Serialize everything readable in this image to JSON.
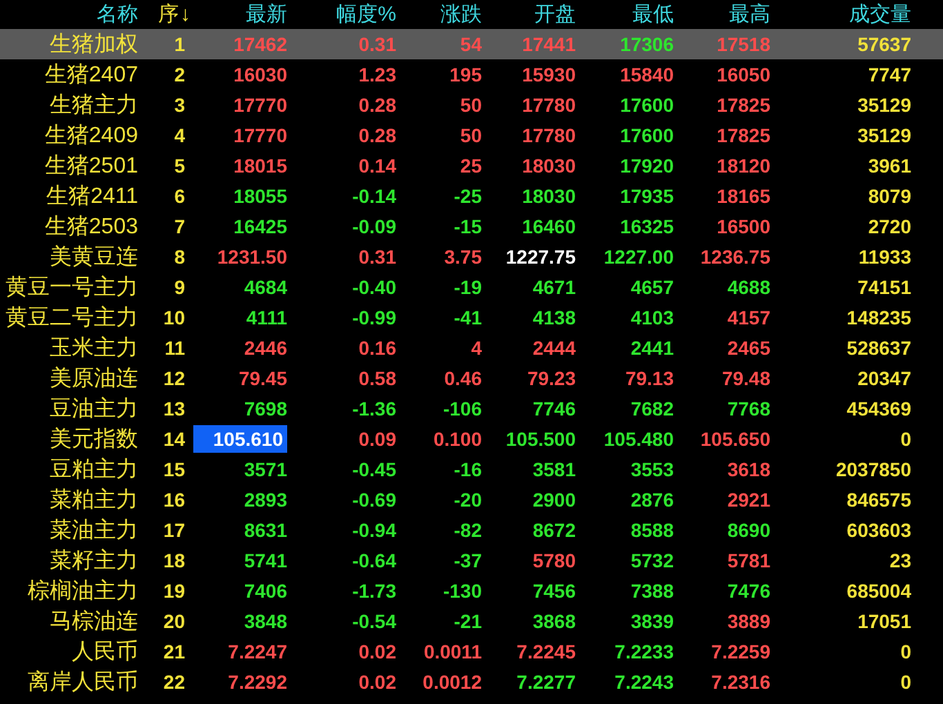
{
  "columns": [
    {
      "label": "名称",
      "kind": "name"
    },
    {
      "label": "序",
      "kind": "index",
      "sort_indicator": "↓"
    },
    {
      "label": "最新",
      "kind": "price"
    },
    {
      "label": "幅度%",
      "kind": "price"
    },
    {
      "label": "涨跌",
      "kind": "price"
    },
    {
      "label": "开盘",
      "kind": "price"
    },
    {
      "label": "最低",
      "kind": "price"
    },
    {
      "label": "最高",
      "kind": "price"
    },
    {
      "label": "成交量",
      "kind": "volume"
    }
  ],
  "rows": [
    {
      "name": "生猪加权",
      "no": "1",
      "selected": true,
      "cells": [
        {
          "v": "17462",
          "kind": "up"
        },
        {
          "v": "0.31",
          "kind": "up"
        },
        {
          "v": "54",
          "kind": "up"
        },
        {
          "v": "17441",
          "kind": "up"
        },
        {
          "v": "17306",
          "kind": "down"
        },
        {
          "v": "17518",
          "kind": "up"
        }
      ],
      "volume": "57637"
    },
    {
      "name": "生猪2407",
      "no": "2",
      "selected": false,
      "cells": [
        {
          "v": "16030",
          "kind": "up"
        },
        {
          "v": "1.23",
          "kind": "up"
        },
        {
          "v": "195",
          "kind": "up"
        },
        {
          "v": "15930",
          "kind": "up"
        },
        {
          "v": "15840",
          "kind": "up"
        },
        {
          "v": "16050",
          "kind": "up"
        }
      ],
      "volume": "7747"
    },
    {
      "name": "生猪主力",
      "no": "3",
      "selected": false,
      "cells": [
        {
          "v": "17770",
          "kind": "up"
        },
        {
          "v": "0.28",
          "kind": "up"
        },
        {
          "v": "50",
          "kind": "up"
        },
        {
          "v": "17780",
          "kind": "up"
        },
        {
          "v": "17600",
          "kind": "down"
        },
        {
          "v": "17825",
          "kind": "up"
        }
      ],
      "volume": "35129"
    },
    {
      "name": "生猪2409",
      "no": "4",
      "selected": false,
      "cells": [
        {
          "v": "17770",
          "kind": "up"
        },
        {
          "v": "0.28",
          "kind": "up"
        },
        {
          "v": "50",
          "kind": "up"
        },
        {
          "v": "17780",
          "kind": "up"
        },
        {
          "v": "17600",
          "kind": "down"
        },
        {
          "v": "17825",
          "kind": "up"
        }
      ],
      "volume": "35129"
    },
    {
      "name": "生猪2501",
      "no": "5",
      "selected": false,
      "cells": [
        {
          "v": "18015",
          "kind": "up"
        },
        {
          "v": "0.14",
          "kind": "up"
        },
        {
          "v": "25",
          "kind": "up"
        },
        {
          "v": "18030",
          "kind": "up"
        },
        {
          "v": "17920",
          "kind": "down"
        },
        {
          "v": "18120",
          "kind": "up"
        }
      ],
      "volume": "3961"
    },
    {
      "name": "生猪2411",
      "no": "6",
      "selected": false,
      "cells": [
        {
          "v": "18055",
          "kind": "down"
        },
        {
          "v": "-0.14",
          "kind": "down"
        },
        {
          "v": "-25",
          "kind": "down"
        },
        {
          "v": "18030",
          "kind": "down"
        },
        {
          "v": "17935",
          "kind": "down"
        },
        {
          "v": "18165",
          "kind": "up"
        }
      ],
      "volume": "8079"
    },
    {
      "name": "生猪2503",
      "no": "7",
      "selected": false,
      "cells": [
        {
          "v": "16425",
          "kind": "down"
        },
        {
          "v": "-0.09",
          "kind": "down"
        },
        {
          "v": "-15",
          "kind": "down"
        },
        {
          "v": "16460",
          "kind": "down"
        },
        {
          "v": "16325",
          "kind": "down"
        },
        {
          "v": "16500",
          "kind": "up"
        }
      ],
      "volume": "2720"
    },
    {
      "name": "美黄豆连",
      "no": "8",
      "selected": false,
      "cells": [
        {
          "v": "1231.50",
          "kind": "up"
        },
        {
          "v": "0.31",
          "kind": "up"
        },
        {
          "v": "3.75",
          "kind": "up"
        },
        {
          "v": "1227.75",
          "kind": "flat"
        },
        {
          "v": "1227.00",
          "kind": "down"
        },
        {
          "v": "1236.75",
          "kind": "up"
        }
      ],
      "volume": "11933"
    },
    {
      "name": "黄豆一号主力",
      "no": "9",
      "selected": false,
      "cells": [
        {
          "v": "4684",
          "kind": "down"
        },
        {
          "v": "-0.40",
          "kind": "down"
        },
        {
          "v": "-19",
          "kind": "down"
        },
        {
          "v": "4671",
          "kind": "down"
        },
        {
          "v": "4657",
          "kind": "down"
        },
        {
          "v": "4688",
          "kind": "down"
        }
      ],
      "volume": "74151"
    },
    {
      "name": "黄豆二号主力",
      "no": "10",
      "selected": false,
      "cells": [
        {
          "v": "4111",
          "kind": "down"
        },
        {
          "v": "-0.99",
          "kind": "down"
        },
        {
          "v": "-41",
          "kind": "down"
        },
        {
          "v": "4138",
          "kind": "down"
        },
        {
          "v": "4103",
          "kind": "down"
        },
        {
          "v": "4157",
          "kind": "up"
        }
      ],
      "volume": "148235"
    },
    {
      "name": "玉米主力",
      "no": "11",
      "selected": false,
      "cells": [
        {
          "v": "2446",
          "kind": "up"
        },
        {
          "v": "0.16",
          "kind": "up"
        },
        {
          "v": "4",
          "kind": "up"
        },
        {
          "v": "2444",
          "kind": "up"
        },
        {
          "v": "2441",
          "kind": "down"
        },
        {
          "v": "2465",
          "kind": "up"
        }
      ],
      "volume": "528637"
    },
    {
      "name": "美原油连",
      "no": "12",
      "selected": false,
      "cells": [
        {
          "v": "79.45",
          "kind": "up"
        },
        {
          "v": "0.58",
          "kind": "up"
        },
        {
          "v": "0.46",
          "kind": "up"
        },
        {
          "v": "79.23",
          "kind": "up"
        },
        {
          "v": "79.13",
          "kind": "up"
        },
        {
          "v": "79.48",
          "kind": "up"
        }
      ],
      "volume": "20347"
    },
    {
      "name": "豆油主力",
      "no": "13",
      "selected": false,
      "cells": [
        {
          "v": "7698",
          "kind": "down"
        },
        {
          "v": "-1.36",
          "kind": "down"
        },
        {
          "v": "-106",
          "kind": "down"
        },
        {
          "v": "7746",
          "kind": "down"
        },
        {
          "v": "7682",
          "kind": "down"
        },
        {
          "v": "7768",
          "kind": "down"
        }
      ],
      "volume": "454369"
    },
    {
      "name": "美元指数",
      "no": "14",
      "selected": false,
      "cells": [
        {
          "v": "105.610",
          "highlighted": true
        },
        {
          "v": "0.09",
          "kind": "up"
        },
        {
          "v": "0.100",
          "kind": "up"
        },
        {
          "v": "105.500",
          "kind": "down"
        },
        {
          "v": "105.480",
          "kind": "down"
        },
        {
          "v": "105.650",
          "kind": "up"
        }
      ],
      "volume": "0"
    },
    {
      "name": "豆粕主力",
      "no": "15",
      "selected": false,
      "cells": [
        {
          "v": "3571",
          "kind": "down"
        },
        {
          "v": "-0.45",
          "kind": "down"
        },
        {
          "v": "-16",
          "kind": "down"
        },
        {
          "v": "3581",
          "kind": "down"
        },
        {
          "v": "3553",
          "kind": "down"
        },
        {
          "v": "3618",
          "kind": "up"
        }
      ],
      "volume": "2037850"
    },
    {
      "name": "菜粕主力",
      "no": "16",
      "selected": false,
      "cells": [
        {
          "v": "2893",
          "kind": "down"
        },
        {
          "v": "-0.69",
          "kind": "down"
        },
        {
          "v": "-20",
          "kind": "down"
        },
        {
          "v": "2900",
          "kind": "down"
        },
        {
          "v": "2876",
          "kind": "down"
        },
        {
          "v": "2921",
          "kind": "up"
        }
      ],
      "volume": "846575"
    },
    {
      "name": "菜油主力",
      "no": "17",
      "selected": false,
      "cells": [
        {
          "v": "8631",
          "kind": "down"
        },
        {
          "v": "-0.94",
          "kind": "down"
        },
        {
          "v": "-82",
          "kind": "down"
        },
        {
          "v": "8672",
          "kind": "down"
        },
        {
          "v": "8588",
          "kind": "down"
        },
        {
          "v": "8690",
          "kind": "down"
        }
      ],
      "volume": "603603"
    },
    {
      "name": "菜籽主力",
      "no": "18",
      "selected": false,
      "cells": [
        {
          "v": "5741",
          "kind": "down"
        },
        {
          "v": "-0.64",
          "kind": "down"
        },
        {
          "v": "-37",
          "kind": "down"
        },
        {
          "v": "5780",
          "kind": "up"
        },
        {
          "v": "5732",
          "kind": "down"
        },
        {
          "v": "5781",
          "kind": "up"
        }
      ],
      "volume": "23"
    },
    {
      "name": "棕榈油主力",
      "no": "19",
      "selected": false,
      "cells": [
        {
          "v": "7406",
          "kind": "down"
        },
        {
          "v": "-1.73",
          "kind": "down"
        },
        {
          "v": "-130",
          "kind": "down"
        },
        {
          "v": "7456",
          "kind": "down"
        },
        {
          "v": "7388",
          "kind": "down"
        },
        {
          "v": "7476",
          "kind": "down"
        }
      ],
      "volume": "685004"
    },
    {
      "name": "马棕油连",
      "no": "20",
      "selected": false,
      "cells": [
        {
          "v": "3848",
          "kind": "down"
        },
        {
          "v": "-0.54",
          "kind": "down"
        },
        {
          "v": "-21",
          "kind": "down"
        },
        {
          "v": "3868",
          "kind": "down"
        },
        {
          "v": "3839",
          "kind": "down"
        },
        {
          "v": "3889",
          "kind": "up"
        }
      ],
      "volume": "17051"
    },
    {
      "name": "人民币",
      "no": "21",
      "selected": false,
      "cells": [
        {
          "v": "7.2247",
          "kind": "up"
        },
        {
          "v": "0.02",
          "kind": "up"
        },
        {
          "v": "0.0011",
          "kind": "up"
        },
        {
          "v": "7.2245",
          "kind": "up"
        },
        {
          "v": "7.2233",
          "kind": "down"
        },
        {
          "v": "7.2259",
          "kind": "up"
        }
      ],
      "volume": "0"
    },
    {
      "name": "离岸人民币",
      "no": "22",
      "selected": false,
      "cells": [
        {
          "v": "7.2292",
          "kind": "up"
        },
        {
          "v": "0.02",
          "kind": "up"
        },
        {
          "v": "0.0012",
          "kind": "up"
        },
        {
          "v": "7.2277",
          "kind": "down"
        },
        {
          "v": "7.2243",
          "kind": "down"
        },
        {
          "v": "7.2316",
          "kind": "up"
        }
      ],
      "volume": "0"
    }
  ]
}
